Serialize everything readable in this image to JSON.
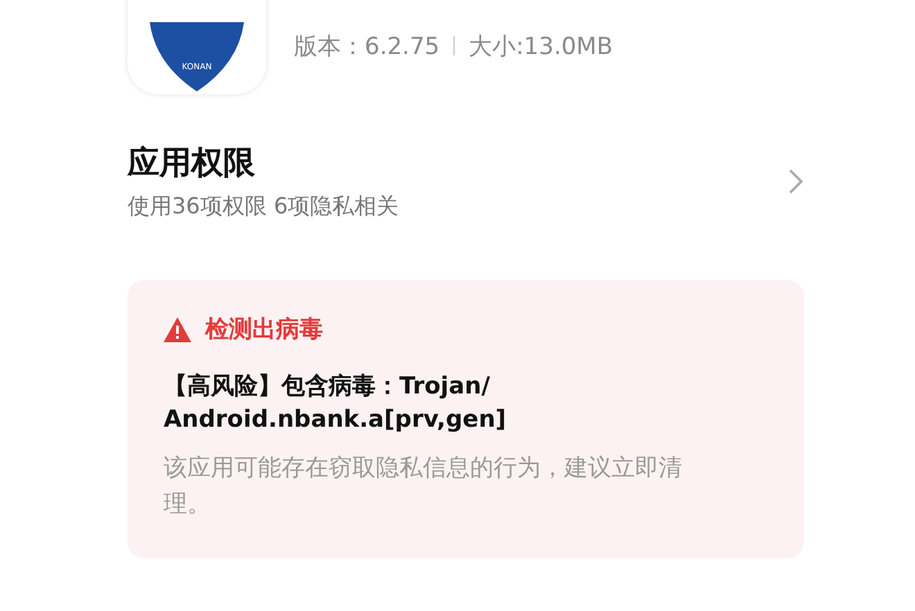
{
  "app": {
    "icon_label": "KONAN",
    "version": "版本：6.2.75",
    "size": "大小:13.0MB"
  },
  "permissions": {
    "title": "应用权限",
    "summary": "使用36项权限 6项隐私相关"
  },
  "alert": {
    "title": "检测出病毒",
    "threat_lines": [
      "【高风险】包含病毒：Trojan/",
      "Android.nbank.a[prv,gen]"
    ],
    "advice": "该应用可能存在窃取隐私信息的行为，建议立即清理。"
  }
}
